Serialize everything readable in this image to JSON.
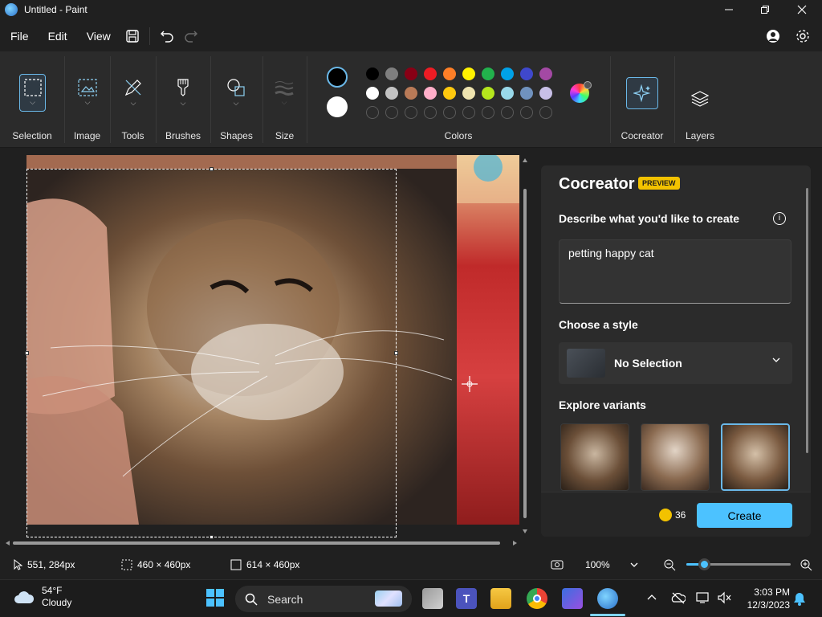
{
  "window": {
    "title": "Untitled - Paint"
  },
  "menu": {
    "file": "File",
    "edit": "Edit",
    "view": "View"
  },
  "ribbon": {
    "groups": {
      "selection": "Selection",
      "image": "Image",
      "tools": "Tools",
      "brushes": "Brushes",
      "shapes": "Shapes",
      "size": "Size",
      "colors": "Colors",
      "cocreator": "Cocreator",
      "layers": "Layers"
    },
    "primary_color": "#000000",
    "secondary_color": "#ffffff",
    "palette_row1": [
      "#000000",
      "#7f7f7f",
      "#880015",
      "#ed1c24",
      "#ff7f27",
      "#fff200",
      "#22b14c",
      "#00a2e8",
      "#3f48cc",
      "#a349a4"
    ],
    "palette_row2": [
      "#ffffff",
      "#c3c3c3",
      "#b97a57",
      "#ffaec9",
      "#ffc90e",
      "#efe4b0",
      "#b5e61d",
      "#99d9ea",
      "#7092be",
      "#c8bfe7"
    ]
  },
  "cocreator": {
    "title": "Cocreator",
    "badge": "PREVIEW",
    "describe_label": "Describe what you'd like to create",
    "prompt": "petting happy cat",
    "style_label": "Choose a style",
    "style_value": "No Selection",
    "variants_label": "Explore variants",
    "credits": "36",
    "create_button": "Create"
  },
  "status": {
    "cursor": "551, 284px",
    "selection_size": "460 × 460px",
    "canvas_size": "614 × 460px",
    "zoom": "100%",
    "zoom_level": 0.17
  },
  "taskbar": {
    "temperature": "54°F",
    "condition": "Cloudy",
    "search_placeholder": "Search",
    "time": "3:03 PM",
    "date": "12/3/2023"
  }
}
